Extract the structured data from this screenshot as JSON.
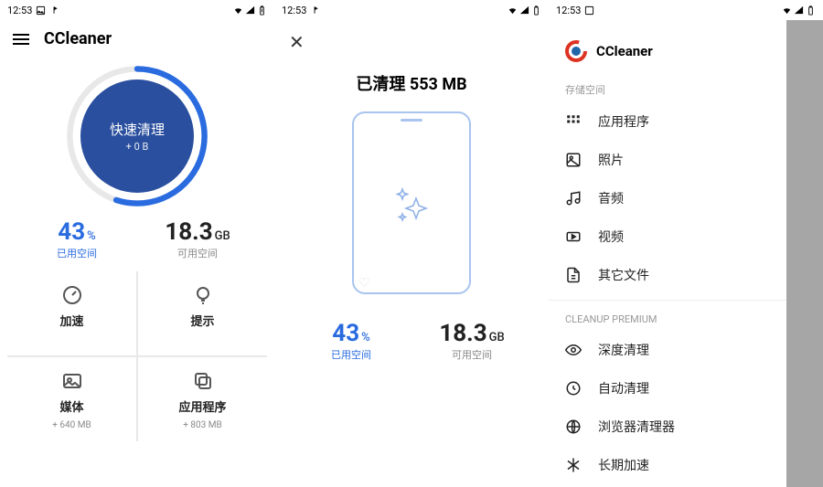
{
  "status": {
    "time": "12:53"
  },
  "panel1": {
    "title": "CCleaner",
    "ring": {
      "line1": "快速清理",
      "line2": "+ 0 B",
      "percent": 55
    },
    "used": {
      "value": "43",
      "unit": "%",
      "label": "已用空间"
    },
    "free": {
      "value": "18.3",
      "unit": "GB",
      "label": "可用空间"
    },
    "cells": {
      "boost": {
        "label": "加速"
      },
      "tips": {
        "label": "提示"
      },
      "media": {
        "label": "媒体",
        "sub": "+ 640 MB"
      },
      "apps": {
        "label": "应用程序",
        "sub": "+ 803 MB"
      }
    }
  },
  "panel2": {
    "cleaned": "已清理 553 MB",
    "used": {
      "value": "43",
      "unit": "%",
      "label": "已用空间"
    },
    "free": {
      "value": "18.3",
      "unit": "GB",
      "label": "可用空间"
    }
  },
  "panel3": {
    "brand": "CCleaner",
    "section1": "存储空间",
    "items1": [
      {
        "label": "应用程序",
        "icon": "grid"
      },
      {
        "label": "照片",
        "icon": "photo"
      },
      {
        "label": "音频",
        "icon": "music"
      },
      {
        "label": "视频",
        "icon": "video"
      },
      {
        "label": "其它文件",
        "icon": "file"
      }
    ],
    "section2": "CLEANUP PREMIUM",
    "items2": [
      {
        "label": "深度清理",
        "icon": "eye"
      },
      {
        "label": "自动清理",
        "icon": "auto"
      },
      {
        "label": "浏览器清理器",
        "icon": "globe"
      },
      {
        "label": "长期加速",
        "icon": "snow"
      }
    ]
  }
}
